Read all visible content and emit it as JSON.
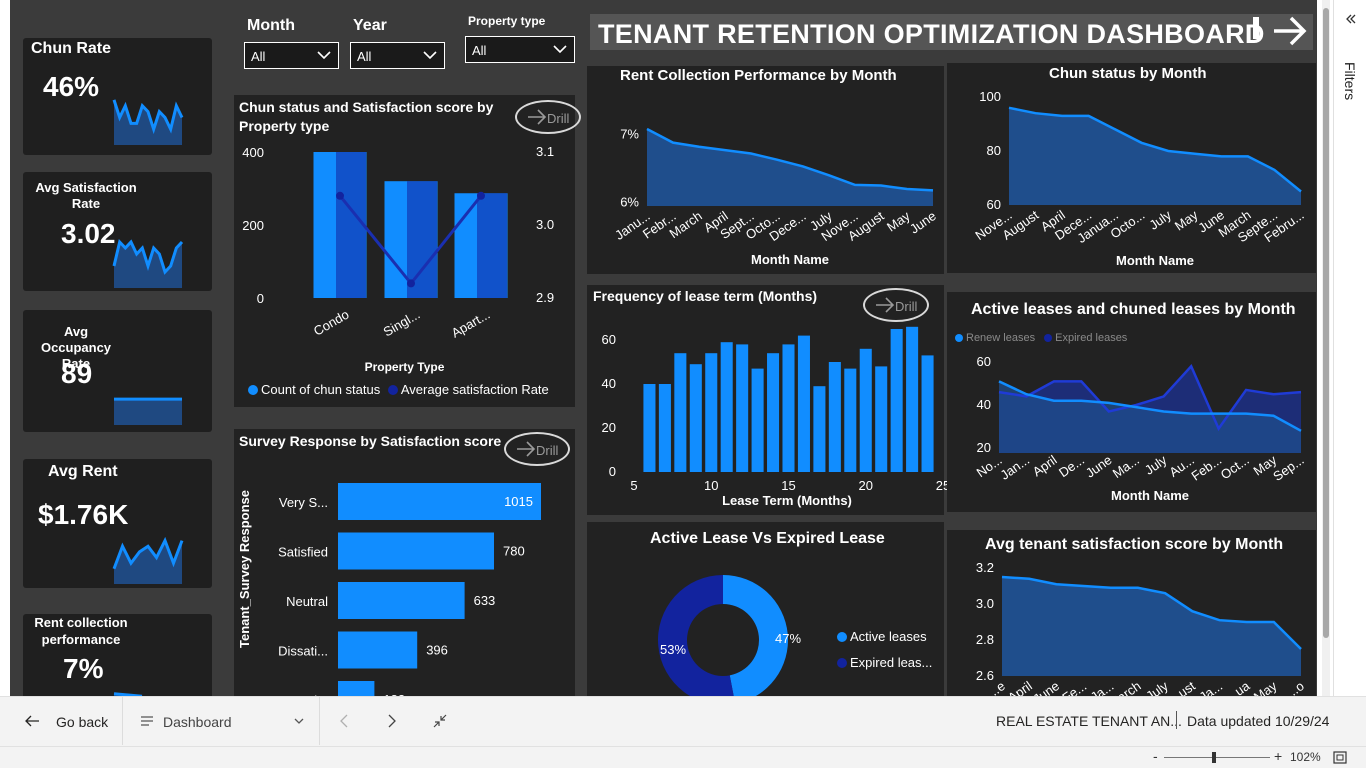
{
  "dashboard_title": "TENANT RETENTION OPTIMIZATION DASHBOARD",
  "slicers": [
    {
      "label": "Month",
      "value": "All"
    },
    {
      "label": "Year",
      "value": "All"
    },
    {
      "label": "Property type",
      "value": "All"
    }
  ],
  "kpi_cards": [
    {
      "title": "Chun Rate",
      "value": "46%",
      "trend": [
        7,
        4,
        6,
        3,
        3,
        6,
        5,
        2,
        5,
        4,
        2,
        6,
        4
      ]
    },
    {
      "title": "Avg Satisfaction Rate",
      "value": "3.02",
      "trend": [
        3,
        7,
        6,
        7,
        5,
        6,
        3,
        6,
        5,
        2,
        3,
        6,
        7
      ]
    },
    {
      "title": "Avg Occupancy Rate",
      "value": "89",
      "trend": [
        5,
        5,
        5,
        5,
        5,
        5,
        5
      ]
    },
    {
      "title": "Avg Rent",
      "value": "$1.76K",
      "trend": [
        2,
        6,
        3,
        5,
        6,
        4,
        7,
        3,
        7
      ]
    },
    {
      "title": "Rent collection performance",
      "value": "7%",
      "trend": [
        5,
        3
      ]
    }
  ],
  "drill_label": "Drill",
  "charts": {
    "property": {
      "title": "Chun status and Satisfaction score by Property type",
      "xlabel": "Property Type",
      "legend": [
        "Count of chun status",
        "Average satisfaction Rate"
      ],
      "left_ticks": [
        "400",
        "200",
        "0"
      ],
      "right_ticks": [
        "3.1",
        "3.0",
        "2.9"
      ],
      "categories": [
        "Condo",
        "Singl...",
        "Apart..."
      ]
    },
    "survey": {
      "title": "Survey Response by Satisfaction score",
      "ylabel": "Tenant_Survey Response",
      "categories": [
        "Very S...",
        "Satisfied",
        "Neutral",
        "Dissati...",
        "Very Di..."
      ],
      "value_labels": [
        "1015",
        "780",
        "633",
        "396",
        "182"
      ]
    },
    "rent_collection": {
      "title": "Rent Collection Performance by Month",
      "xlabel": "Month Name",
      "y_ticks": [
        "7%",
        "6%"
      ],
      "x_labels": [
        "Janu...",
        "Febr...",
        "March",
        "April",
        "Sept...",
        "Octo...",
        "Dece...",
        "July",
        "Nove...",
        "August",
        "May",
        "June"
      ]
    },
    "lease_term": {
      "title": "Frequency of lease term (Months)",
      "xlabel": "Lease Term (Months)",
      "y_ticks": [
        "60",
        "40",
        "20",
        "0"
      ],
      "x_ticks": [
        "5",
        "10",
        "15",
        "20",
        "25"
      ]
    },
    "donut": {
      "title": "Active Lease Vs Expired Lease",
      "legend": [
        "Active leases",
        "Expired leas..."
      ],
      "labels": [
        "47%",
        "53%"
      ]
    },
    "churn_month": {
      "title": "Chun status by Month",
      "xlabel": "Month Name",
      "y_ticks": [
        "100",
        "80",
        "60"
      ],
      "x_labels": [
        "Nove...",
        "August",
        "April",
        "Dece...",
        "Janua...",
        "Octo...",
        "July",
        "May",
        "June",
        "March",
        "Septe...",
        "Febru..."
      ]
    },
    "active_churned": {
      "title": "Active leases and chuned leases by Month",
      "xlabel": "Month Name",
      "legend": [
        "Renew leases",
        "Expired leases"
      ],
      "y_ticks": [
        "60",
        "40",
        "20"
      ],
      "x_labels": [
        "No...",
        "Jan...",
        "April",
        "De...",
        "June",
        "Ma...",
        "July",
        "Au...",
        "Feb...",
        "Oct...",
        "May",
        "Sep..."
      ]
    },
    "satisfaction_month": {
      "title": "Avg tenant satisfaction score by Month",
      "y_ticks": [
        "3.2",
        "3.0",
        "2.8",
        "2.6"
      ],
      "x_labels": [
        "...e",
        "April",
        "June",
        "Fe...",
        "Ja...",
        "March",
        "July",
        "...ust",
        "Ja...",
        "...ua",
        "May",
        "...o"
      ]
    }
  },
  "chart_data": [
    {
      "type": "bar",
      "title": "Chun status and Satisfaction score by Property type",
      "categories": [
        "Condo",
        "Singl...",
        "Apart..."
      ],
      "series": [
        {
          "name": "Count of chun status",
          "values": [
            400,
            320,
            287
          ]
        },
        {
          "name": "Average satisfaction Rate",
          "values": [
            3.04,
            2.92,
            3.04
          ]
        }
      ],
      "xlabel": "Property Type",
      "ylim": [
        0,
        400
      ],
      "y2lim": [
        2.9,
        3.1
      ]
    },
    {
      "type": "bar",
      "title": "Survey Response by Satisfaction score",
      "categories": [
        "Very S...",
        "Satisfied",
        "Neutral",
        "Dissati...",
        "Very Di..."
      ],
      "values": [
        1015,
        780,
        633,
        396,
        182
      ],
      "ylabel": "Tenant_Survey Response"
    },
    {
      "type": "area",
      "title": "Rent Collection Performance by Month",
      "categories": [
        "Janu...",
        "Febr...",
        "March",
        "April",
        "Sept...",
        "Octo...",
        "Dece...",
        "July",
        "Nove...",
        "August",
        "May",
        "June"
      ],
      "values": [
        7.08,
        6.88,
        6.82,
        6.77,
        6.72,
        6.63,
        6.53,
        6.4,
        6.26,
        6.25,
        6.2,
        6.18
      ],
      "ylim": [
        5.95,
        7.3
      ],
      "xlabel": "Month Name"
    },
    {
      "type": "bar",
      "title": "Frequency of lease term (Months)",
      "x": [
        6,
        7,
        8,
        9,
        10,
        11,
        12,
        13,
        14,
        15,
        16,
        17,
        18,
        19,
        20,
        21,
        22,
        23,
        24
      ],
      "values": [
        40,
        40,
        54,
        49,
        54,
        59,
        58,
        47,
        54,
        58,
        62,
        39,
        50,
        47,
        56,
        48,
        65,
        66,
        53
      ],
      "xlim": [
        5,
        25
      ],
      "ylim": [
        0,
        60
      ],
      "xlabel": "Lease Term (Months)"
    },
    {
      "type": "pie",
      "title": "Active Lease Vs Expired Lease",
      "categories": [
        "Active leases",
        "Expired leases"
      ],
      "values": [
        47,
        53
      ]
    },
    {
      "type": "area",
      "title": "Chun status by Month",
      "categories": [
        "Nove...",
        "August",
        "April",
        "Dece...",
        "Janua...",
        "Octo...",
        "July",
        "May",
        "June",
        "March",
        "Septe...",
        "Febru..."
      ],
      "values": [
        96,
        94,
        93,
        93,
        88,
        83,
        80,
        79,
        78,
        78,
        73,
        65
      ],
      "ylim": [
        60,
        100
      ],
      "xlabel": "Month Name"
    },
    {
      "type": "area",
      "title": "Active leases and chuned leases by Month",
      "categories": [
        "No...",
        "Jan...",
        "April",
        "De...",
        "June",
        "Ma...",
        "July",
        "Au...",
        "Feb...",
        "Oct...",
        "May",
        "Sep..."
      ],
      "series": [
        {
          "name": "Renew leases",
          "values": [
            51,
            45,
            42,
            42,
            41,
            39,
            37,
            36,
            36,
            36,
            35,
            28
          ]
        },
        {
          "name": "Expired leases",
          "values": [
            46,
            44,
            51,
            51,
            37,
            40,
            44,
            58,
            29,
            47,
            45,
            46
          ]
        }
      ],
      "ylim": [
        20,
        60
      ],
      "xlabel": "Month Name"
    },
    {
      "type": "area",
      "title": "Avg tenant satisfaction score by Month",
      "categories": [
        "...e",
        "April",
        "June",
        "Fe...",
        "Ja...",
        "March",
        "July",
        "...ust",
        "Ja...",
        "...ua",
        "May",
        "...o"
      ],
      "values": [
        3.15,
        3.14,
        3.11,
        3.1,
        3.09,
        3.09,
        3.06,
        2.96,
        2.91,
        2.9,
        2.9,
        2.75
      ],
      "ylim": [
        2.6,
        3.2
      ]
    }
  ],
  "nav": {
    "back_label": "Go back",
    "page_label": "Dashboard"
  },
  "report_name": "REAL ESTATE TENANT AN...",
  "data_updated": "Data updated 10/29/24",
  "zoom": "102%",
  "filters_label": "Filters",
  "colors": {
    "bar": "#118dff",
    "dark": "#12239e",
    "area": "#1f4e8c",
    "panel": "#222222",
    "canvas": "#3b3b3b"
  }
}
